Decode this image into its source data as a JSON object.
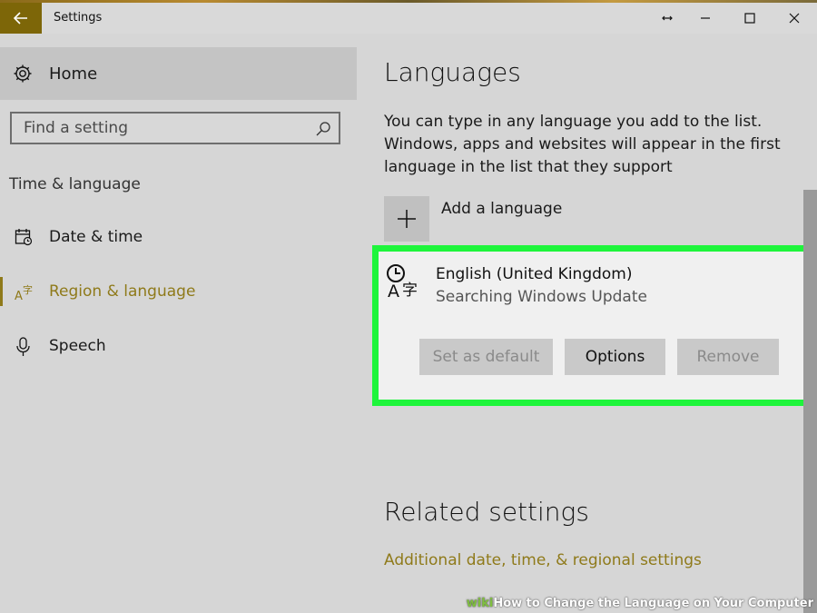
{
  "window": {
    "title": "Settings",
    "back_icon": "arrow-left-icon",
    "controls": [
      "resize-icon",
      "minimize-icon",
      "maximize-icon",
      "close-icon"
    ],
    "accent_color": "#7d6608"
  },
  "sidebar": {
    "home_label": "Home",
    "search_placeholder": "Find a setting",
    "section_heading": "Time & language",
    "items": [
      {
        "label": "Date & time",
        "icon": "calendar-clock-icon",
        "active": false
      },
      {
        "label": "Region & language",
        "icon": "language-icon",
        "active": true
      },
      {
        "label": "Speech",
        "icon": "microphone-icon",
        "active": false
      }
    ]
  },
  "main": {
    "title": "Languages",
    "description": "You can type in any language you add to the list. Windows, apps and websites will appear in the first language in the list that they support",
    "add_language_label": "Add a language",
    "language": {
      "name": "English (United Kingdom)",
      "status": "Searching Windows Update",
      "buttons": {
        "set_default": "Set as default",
        "options": "Options",
        "remove": "Remove"
      }
    },
    "related_title": "Related settings",
    "related_link": "Additional date, time, & regional settings"
  },
  "highlight_color": "#1ef53b",
  "watermark": {
    "prefix": "wiki",
    "text": "How to Change the Language on Your Computer"
  }
}
